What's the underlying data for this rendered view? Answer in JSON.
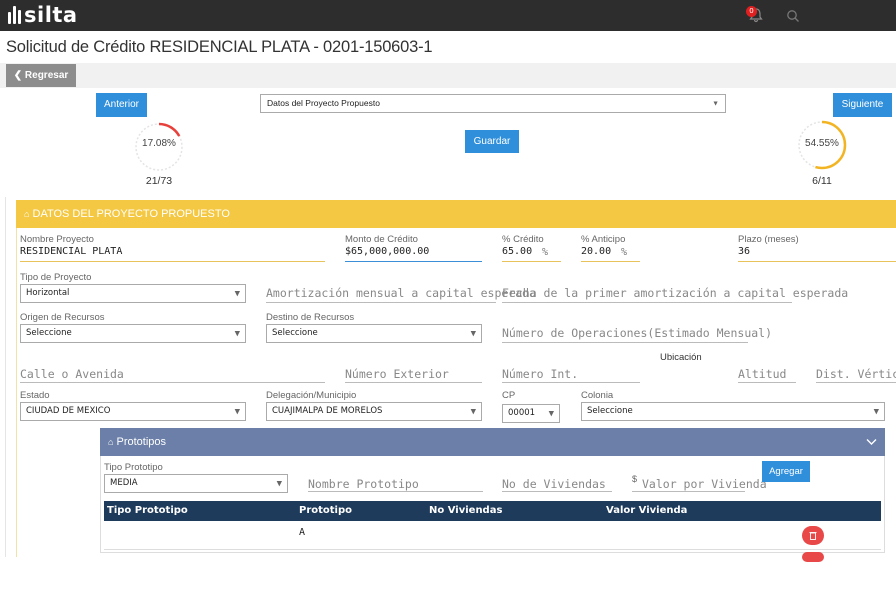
{
  "app": {
    "logo_text": "silta",
    "notification_count": "0"
  },
  "header": {
    "title": "Solicitud de Crédito RESIDENCIAL PLATA - 0201-150603-1",
    "back_label": "Regresar"
  },
  "nav": {
    "prev_label": "Anterior",
    "next_label": "Siguiente",
    "save_label": "Guardar",
    "page_select_value": "Datos del Proyecto Propuesto",
    "progress_left": {
      "percent_text": "17.08%",
      "count": "21/73",
      "fraction": 0.1708,
      "color": "#e8413c"
    },
    "progress_right": {
      "percent_text": "54.55%",
      "count": "6/11",
      "fraction": 0.5455,
      "color": "#f2b422"
    }
  },
  "section": {
    "title": "DATOS DEL PROYECTO PROPUESTO",
    "accent_color": "#f4c842"
  },
  "form": {
    "nombre_proyecto": {
      "label": "Nombre Proyecto",
      "value": "RESIDENCIAL PLATA"
    },
    "monto_credito": {
      "label": "Monto de Crédito",
      "value": "$65,000,000.00"
    },
    "pct_credito": {
      "label": "% Crédito",
      "value": "65.00",
      "unit": "%"
    },
    "pct_anticipo": {
      "label": "% Anticipo",
      "value": "20.00",
      "unit": "%"
    },
    "plazo": {
      "label": "Plazo (meses)",
      "value": "36"
    },
    "tipo_proyecto": {
      "label": "Tipo de Proyecto",
      "value": "Horizontal"
    },
    "amortizacion_placeholder": "Amortización mensual a capital esperada",
    "fecha_amortizacion_placeholder": "Fecha de la primer amortización a capital esperada",
    "origen_recursos": {
      "label": "Origen de Recursos",
      "value": "Seleccione"
    },
    "destino_recursos": {
      "label": "Destino de Recursos",
      "value": "Seleccione"
    },
    "num_operaciones_placeholder": "Número de Operaciones(Estimado Mensual)",
    "ubicacion_title": "Ubicación",
    "calle_placeholder": "Calle o Avenida",
    "num_exterior_placeholder": "Número Exterior",
    "num_int_placeholder": "Número Int.",
    "altitud_placeholder": "Altitud",
    "dist_vertice_placeholder": "Dist. Vértice +",
    "estado": {
      "label": "Estado",
      "value": "CIUDAD DE MEXICO"
    },
    "delegacion": {
      "label": "Delegación/Municipio",
      "value": "CUAJIMALPA DE MORELOS"
    },
    "cp": {
      "label": "CP",
      "value": "00001"
    },
    "colonia": {
      "label": "Colonia",
      "value": "Seleccione"
    }
  },
  "prototipos": {
    "title": "Prototipos",
    "tipo_label": "Tipo Prototipo",
    "tipo_value": "MEDIA",
    "nombre_placeholder": "Nombre Prototipo",
    "viviendas_placeholder": "No de Viviendas",
    "valor_prefix": "$",
    "valor_placeholder": "Valor por Vivienda",
    "add_label": "Agregar",
    "columns": [
      "Tipo Prototipo",
      "Prototipo",
      "No Viviendas",
      "Valor Vivienda"
    ],
    "rows": [
      {
        "tipo": "",
        "prototipo": "A",
        "viviendas": "",
        "valor": ""
      }
    ],
    "header_color": "#1f3b5c",
    "panel_color": "#6b7fa8"
  }
}
